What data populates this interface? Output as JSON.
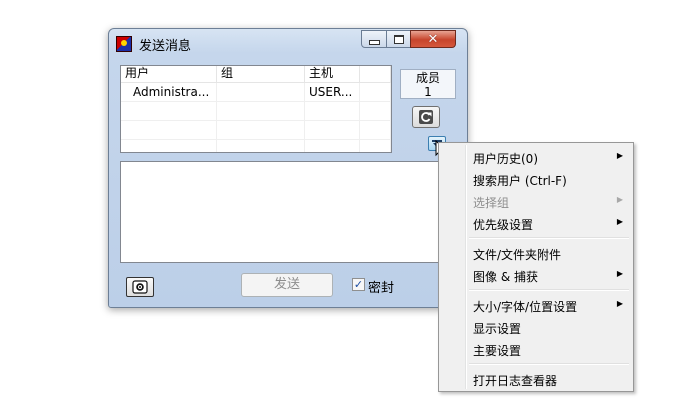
{
  "window": {
    "title": "发送消息",
    "list": {
      "headers": [
        "用户",
        "组",
        "主机"
      ],
      "rows": [
        {
          "user": "Administra...",
          "group": "",
          "host": "USER..."
        }
      ]
    },
    "members": {
      "label": "成员",
      "count": "1"
    },
    "send_label": "发送",
    "seal_label": "密封",
    "seal_checked": true
  },
  "context_menu": {
    "items": [
      {
        "label": "用户历史(0)",
        "submenu": true,
        "disabled": false
      },
      {
        "label": "搜索用户 (Ctrl-F)",
        "submenu": false,
        "disabled": false
      },
      {
        "label": "选择组",
        "submenu": true,
        "disabled": true
      },
      {
        "label": "优先级设置",
        "submenu": true,
        "disabled": false
      },
      {
        "label": "文件/文件夹附件",
        "submenu": false,
        "disabled": false
      },
      {
        "label": "图像 & 捕获",
        "submenu": true,
        "disabled": false
      },
      {
        "label": "大小/字体/位置设置",
        "submenu": true,
        "disabled": false
      },
      {
        "label": "显示设置",
        "submenu": false,
        "disabled": false
      },
      {
        "label": "主要设置",
        "submenu": false,
        "disabled": false
      },
      {
        "label": "打开日志查看器",
        "submenu": false,
        "disabled": false
      }
    ]
  },
  "icons": {
    "app": "app-icon",
    "refresh": "refresh-icon",
    "menu": "dropdown-menu-icon",
    "camera": "camera-icon"
  }
}
